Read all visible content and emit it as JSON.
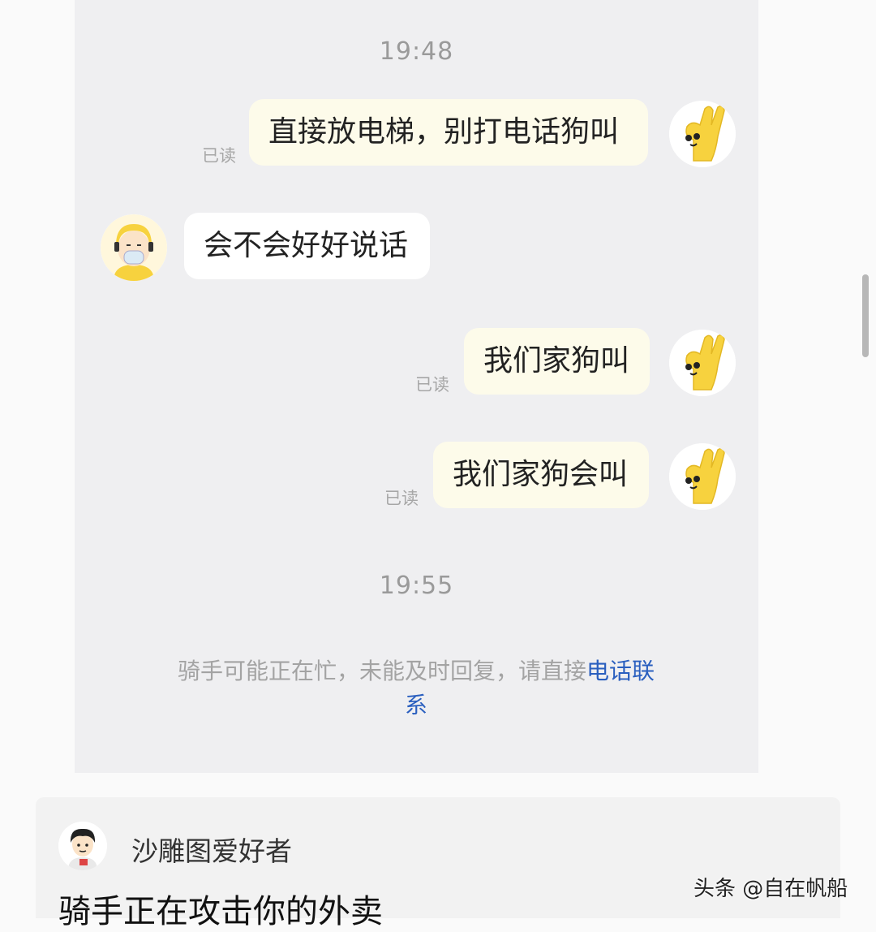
{
  "chat": {
    "time1": "19:48",
    "time2": "19:55",
    "messages": [
      {
        "from": "me",
        "text": "直接放电梯，别打电话狗叫",
        "read": "已读"
      },
      {
        "from": "rider",
        "text": "会不会好好说话"
      },
      {
        "from": "me",
        "text": "我们家狗叫",
        "read": "已读"
      },
      {
        "from": "me",
        "text": "我们家狗会叫",
        "read": "已读"
      }
    ],
    "notice": {
      "text": "骑手可能正在忙，未能及时回复，请直接",
      "link": "电话联系"
    },
    "colors": {
      "link": "#2a5fbf",
      "my_bubble": "#fdfbea",
      "avatar_yellow": "#f7d23e"
    },
    "icons": {
      "my_avatar": "yellow-hand-mascot-icon",
      "rider_avatar": "rider-helmet-mask-icon"
    }
  },
  "comment": {
    "username": "沙雕图爱好者",
    "text": "骑手正在攻击你的外卖",
    "avatar_icon": "cartoon-boy-avatar-icon"
  },
  "watermark": "头条 @自在帆船"
}
